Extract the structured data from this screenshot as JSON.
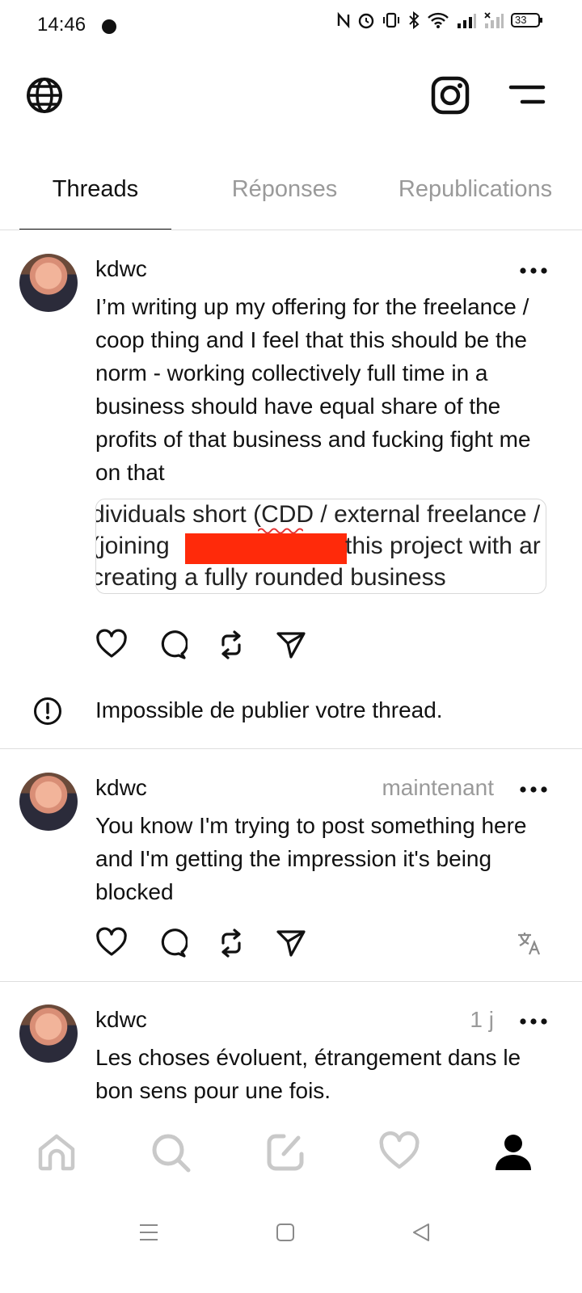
{
  "status_bar": {
    "time": "14:46",
    "battery": "33"
  },
  "header": {
    "left_icon": "globe-icon",
    "right_icons": [
      "instagram-icon",
      "menu-icon"
    ]
  },
  "tabs": [
    {
      "label": "Threads",
      "active": true
    },
    {
      "label": "Réponses",
      "active": false
    },
    {
      "label": "Republications",
      "active": false
    }
  ],
  "posts": [
    {
      "username": "kdwc",
      "timestamp": "",
      "text": "I’m writing up my offering for the freelance / coop thing and I feel that this should be the norm - working collectively full time in a business should have equal share of the profits of that business and fucking fight me on that",
      "embed_lines": [
        "dividuals short (CDD / external freelance /",
        "(joining",
        "this project with ar",
        "creating a fully rounded business"
      ],
      "error": "Impossible de publier votre thread."
    },
    {
      "username": "kdwc",
      "timestamp": "maintenant",
      "text": "You know I'm trying to post something here and I'm getting the impression it's being blocked"
    },
    {
      "username": "kdwc",
      "timestamp": "1 j",
      "text": "Les choses évoluent, étrangement dans le bon sens pour une fois."
    }
  ],
  "bottom_nav": [
    "home-icon",
    "search-icon",
    "compose-icon",
    "heart-icon",
    "profile-icon"
  ],
  "colors": {
    "accent": "#111111",
    "muted": "#9a9a9a",
    "redaction": "#ff2a0a"
  }
}
